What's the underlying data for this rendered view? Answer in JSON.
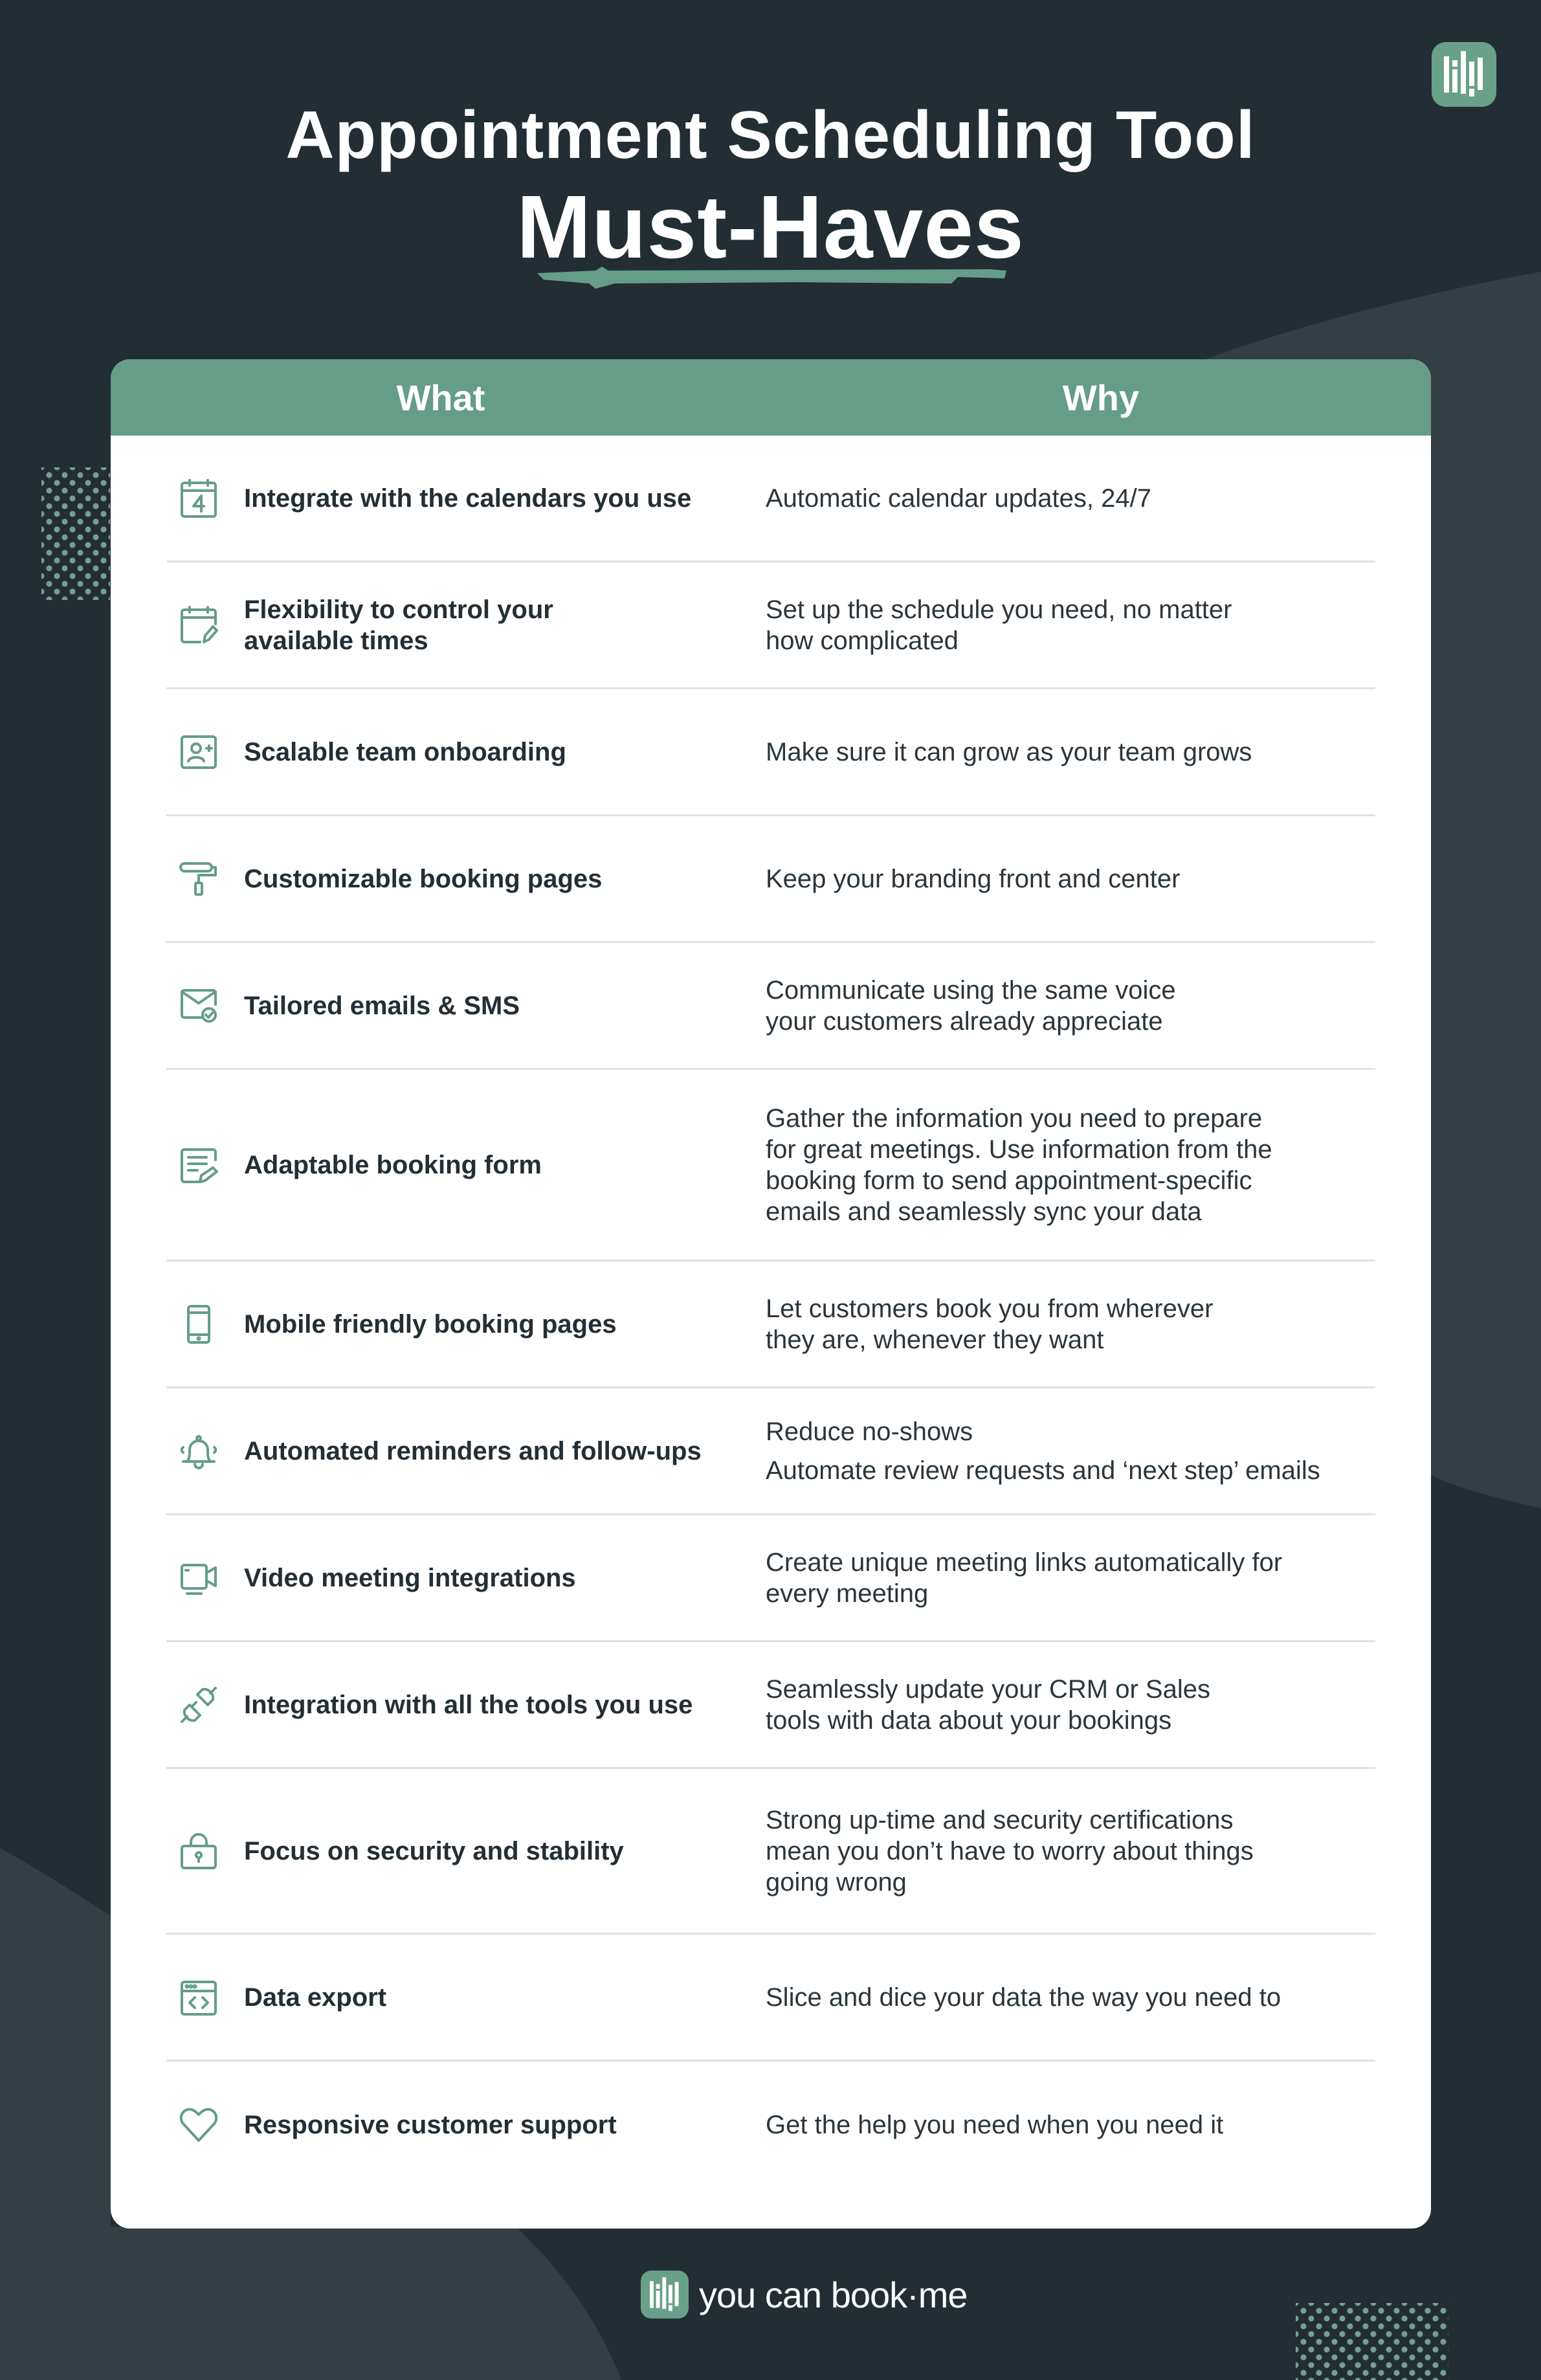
{
  "header": {
    "title_line1": "Appointment Scheduling Tool",
    "title_line2": "Must-Haves"
  },
  "colors": {
    "background": "#232d34",
    "accent": "#659d88",
    "card": "#ffffff",
    "text": "#242e35"
  },
  "table": {
    "columns": [
      "What",
      "Why"
    ],
    "rows": [
      {
        "icon": "calendar-icon",
        "what": [
          "Integrate with the calendars you use"
        ],
        "why": [
          "Automatic calendar updates, 24/7"
        ]
      },
      {
        "icon": "calendar-edit-icon",
        "what": [
          "Flexibility to control your",
          "available times"
        ],
        "why": [
          "Set up the schedule you need, no matter",
          "how complicated"
        ]
      },
      {
        "icon": "add-user-icon",
        "what": [
          "Scalable team onboarding"
        ],
        "why": [
          "Make sure it can grow as your team grows"
        ]
      },
      {
        "icon": "paint-roller-icon",
        "what": [
          "Customizable booking pages"
        ],
        "why": [
          "Keep your branding front and center"
        ]
      },
      {
        "icon": "email-check-icon",
        "what": [
          "Tailored emails & SMS"
        ],
        "why": [
          "Communicate using the same voice",
          "your customers already appreciate"
        ]
      },
      {
        "icon": "form-edit-icon",
        "what": [
          "Adaptable booking form"
        ],
        "why": [
          "Gather the information you need to prepare",
          "for great meetings. Use information from the",
          "booking form to send appointment-specific",
          "emails and seamlessly sync your data"
        ]
      },
      {
        "icon": "mobile-icon",
        "what": [
          "Mobile friendly booking pages"
        ],
        "why": [
          "Let customers book you from wherever",
          "they are, whenever they want"
        ]
      },
      {
        "icon": "bell-icon",
        "what": [
          "Automated reminders and follow-ups"
        ],
        "why_paragraphs": [
          "Reduce no-shows",
          "Automate review requests and ‘next step’ emails"
        ]
      },
      {
        "icon": "video-camera-icon",
        "what": [
          "Video meeting integrations"
        ],
        "why": [
          "Create unique meeting links automatically for",
          "every meeting"
        ]
      },
      {
        "icon": "plug-icon",
        "what": [
          "Integration with all the tools you use"
        ],
        "why": [
          "Seamlessly update your CRM or Sales",
          "tools with data about your bookings"
        ]
      },
      {
        "icon": "lock-icon",
        "what": [
          "Focus on security and stability"
        ],
        "why": [
          "Strong up-time and security certifications",
          "mean you don’t have to worry about things",
          "going wrong"
        ]
      },
      {
        "icon": "code-window-icon",
        "what": [
          "Data export"
        ],
        "why": [
          "Slice and dice your data the way you need to"
        ]
      },
      {
        "icon": "heart-icon",
        "what": [
          "Responsive customer support"
        ],
        "why": [
          "Get the help you need when you need it"
        ]
      }
    ]
  },
  "footer": {
    "brand_name": "you can book·me"
  }
}
